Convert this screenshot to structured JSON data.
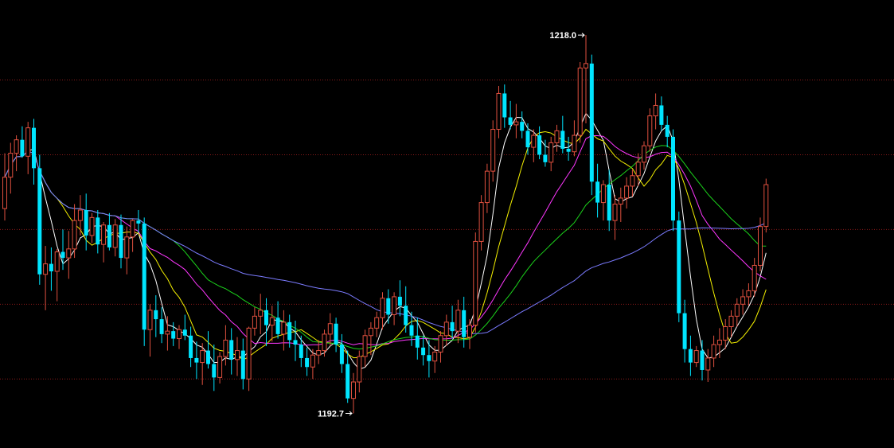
{
  "chart_data": {
    "type": "candlestick",
    "title": "",
    "xlabel": "",
    "ylabel": "",
    "ylim": [
      1191.5,
      1219.5
    ],
    "grid": true,
    "annotations": {
      "high": "1218.0",
      "low": "1192.7"
    },
    "colors": {
      "background": "#000000",
      "grid": "#8a1a1a",
      "up": "#e0503f",
      "down": "#00e5ff",
      "ma1": "#ffffff",
      "ma2": "#f4f000",
      "ma3": "#ff37ff",
      "ma4": "#1bd21b",
      "ma5": "#7b7bff"
    },
    "ohlc": [
      [
        1206.4,
        1210.1,
        1205.6,
        1208.5
      ],
      [
        1208.5,
        1210.8,
        1207.4,
        1210.1
      ],
      [
        1210.1,
        1211.3,
        1208.9,
        1211.0
      ],
      [
        1211.0,
        1211.9,
        1209.8,
        1209.9
      ],
      [
        1209.9,
        1212.2,
        1208.7,
        1211.8
      ],
      [
        1211.8,
        1212.4,
        1208.0,
        1209.1
      ],
      [
        1209.1,
        1210.0,
        1201.3,
        1202.0
      ],
      [
        1202.0,
        1203.9,
        1199.6,
        1202.7
      ],
      [
        1202.7,
        1203.8,
        1200.9,
        1202.2
      ],
      [
        1202.2,
        1203.7,
        1200.2,
        1203.5
      ],
      [
        1203.5,
        1205.0,
        1202.3,
        1203.1
      ],
      [
        1203.1,
        1204.9,
        1201.7,
        1203.7
      ],
      [
        1203.7,
        1206.7,
        1203.1,
        1205.6
      ],
      [
        1205.6,
        1207.3,
        1204.6,
        1206.3
      ],
      [
        1206.3,
        1207.4,
        1203.6,
        1204.6
      ],
      [
        1204.6,
        1206.1,
        1204.1,
        1205.8
      ],
      [
        1205.8,
        1206.3,
        1203.4,
        1204.0
      ],
      [
        1204.0,
        1205.5,
        1202.8,
        1205.3
      ],
      [
        1205.3,
        1206.1,
        1203.6,
        1203.8
      ],
      [
        1203.8,
        1205.7,
        1203.2,
        1205.3
      ],
      [
        1205.3,
        1206.0,
        1202.4,
        1203.1
      ],
      [
        1203.1,
        1205.2,
        1202.0,
        1204.5
      ],
      [
        1204.5,
        1205.7,
        1203.5,
        1205.6
      ],
      [
        1205.6,
        1206.3,
        1204.8,
        1205.4
      ],
      [
        1205.4,
        1205.8,
        1197.2,
        1198.3
      ],
      [
        1198.3,
        1200.0,
        1196.5,
        1199.6
      ],
      [
        1199.6,
        1200.6,
        1197.8,
        1199.0
      ],
      [
        1199.0,
        1199.8,
        1197.4,
        1198.0
      ],
      [
        1198.0,
        1199.2,
        1196.9,
        1198.2
      ],
      [
        1198.2,
        1198.8,
        1197.2,
        1197.7
      ],
      [
        1197.7,
        1198.6,
        1197.0,
        1198.3
      ],
      [
        1198.3,
        1199.3,
        1197.6,
        1197.9
      ],
      [
        1197.9,
        1198.5,
        1195.8,
        1196.4
      ],
      [
        1196.4,
        1197.5,
        1195.0,
        1196.1
      ],
      [
        1196.1,
        1197.4,
        1194.6,
        1196.9
      ],
      [
        1196.9,
        1198.2,
        1195.7,
        1196.0
      ],
      [
        1196.0,
        1197.3,
        1194.2,
        1195.1
      ],
      [
        1195.1,
        1196.8,
        1194.7,
        1196.5
      ],
      [
        1196.5,
        1198.6,
        1195.9,
        1197.6
      ],
      [
        1197.6,
        1198.4,
        1195.3,
        1196.3
      ],
      [
        1196.3,
        1197.8,
        1195.2,
        1196.9
      ],
      [
        1196.9,
        1197.7,
        1194.3,
        1195.0
      ],
      [
        1195.0,
        1198.5,
        1194.2,
        1198.4
      ],
      [
        1198.4,
        1199.8,
        1197.9,
        1199.2
      ],
      [
        1199.2,
        1200.7,
        1198.0,
        1199.6
      ],
      [
        1199.6,
        1200.4,
        1197.2,
        1198.6
      ],
      [
        1198.6,
        1199.9,
        1197.5,
        1199.1
      ],
      [
        1199.1,
        1200.2,
        1197.7,
        1198.0
      ],
      [
        1198.0,
        1199.6,
        1196.9,
        1198.8
      ],
      [
        1198.8,
        1199.3,
        1197.1,
        1197.6
      ],
      [
        1197.6,
        1198.9,
        1196.2,
        1197.3
      ],
      [
        1197.3,
        1197.9,
        1195.8,
        1196.4
      ],
      [
        1196.4,
        1197.1,
        1195.2,
        1195.8
      ],
      [
        1195.8,
        1197.0,
        1195.0,
        1196.6
      ],
      [
        1196.6,
        1197.6,
        1196.0,
        1196.9
      ],
      [
        1196.9,
        1198.3,
        1196.5,
        1198.0
      ],
      [
        1198.0,
        1199.4,
        1197.2,
        1198.7
      ],
      [
        1198.7,
        1199.1,
        1196.8,
        1197.3
      ],
      [
        1197.3,
        1198.0,
        1195.4,
        1196.0
      ],
      [
        1196.0,
        1196.9,
        1193.4,
        1193.7
      ],
      [
        1193.7,
        1195.4,
        1192.7,
        1194.8
      ],
      [
        1194.8,
        1196.9,
        1194.1,
        1196.5
      ],
      [
        1196.5,
        1198.3,
        1195.8,
        1197.9
      ],
      [
        1197.9,
        1198.8,
        1196.6,
        1198.4
      ],
      [
        1198.4,
        1199.5,
        1197.8,
        1199.1
      ],
      [
        1199.1,
        1200.8,
        1198.3,
        1200.4
      ],
      [
        1200.4,
        1201.0,
        1198.7,
        1199.3
      ],
      [
        1199.3,
        1200.8,
        1198.6,
        1200.5
      ],
      [
        1200.5,
        1201.6,
        1199.2,
        1199.9
      ],
      [
        1199.9,
        1201.2,
        1198.1,
        1198.6
      ],
      [
        1198.6,
        1199.5,
        1197.2,
        1197.9
      ],
      [
        1197.9,
        1199.1,
        1196.3,
        1197.1
      ],
      [
        1197.1,
        1197.9,
        1195.9,
        1196.6
      ],
      [
        1196.6,
        1197.6,
        1195.1,
        1196.2
      ],
      [
        1196.2,
        1197.2,
        1195.4,
        1196.8
      ],
      [
        1196.8,
        1198.2,
        1196.1,
        1197.9
      ],
      [
        1197.9,
        1199.3,
        1197.2,
        1198.8
      ],
      [
        1198.8,
        1199.9,
        1197.7,
        1198.2
      ],
      [
        1198.2,
        1200.3,
        1197.4,
        1199.6
      ],
      [
        1199.6,
        1200.5,
        1197.1,
        1197.8
      ],
      [
        1197.8,
        1199.0,
        1197.0,
        1198.6
      ],
      [
        1198.6,
        1204.8,
        1198.1,
        1204.2
      ],
      [
        1204.2,
        1207.3,
        1203.6,
        1206.8
      ],
      [
        1206.8,
        1209.4,
        1206.1,
        1208.9
      ],
      [
        1208.9,
        1212.3,
        1208.2,
        1211.7
      ],
      [
        1211.7,
        1214.6,
        1211.1,
        1214.1
      ],
      [
        1214.1,
        1214.7,
        1211.8,
        1212.5
      ],
      [
        1212.5,
        1213.6,
        1211.7,
        1212.0
      ],
      [
        1212.0,
        1213.4,
        1211.1,
        1212.2
      ],
      [
        1212.2,
        1212.9,
        1211.1,
        1211.6
      ],
      [
        1211.6,
        1212.1,
        1210.0,
        1210.5
      ],
      [
        1210.5,
        1211.7,
        1209.5,
        1211.3
      ],
      [
        1211.3,
        1211.9,
        1209.7,
        1210.0
      ],
      [
        1210.0,
        1211.0,
        1209.2,
        1209.5
      ],
      [
        1209.5,
        1211.2,
        1208.9,
        1210.8
      ],
      [
        1210.8,
        1212.0,
        1210.2,
        1211.6
      ],
      [
        1211.6,
        1212.6,
        1210.1,
        1210.4
      ],
      [
        1210.4,
        1211.2,
        1209.6,
        1210.2
      ],
      [
        1210.2,
        1212.3,
        1209.9,
        1211.3
      ],
      [
        1211.3,
        1216.2,
        1210.8,
        1215.8
      ],
      [
        1215.8,
        1218.0,
        1212.1,
        1216.1
      ],
      [
        1216.1,
        1216.7,
        1207.3,
        1208.2
      ],
      [
        1208.2,
        1209.4,
        1205.8,
        1206.8
      ],
      [
        1206.8,
        1208.3,
        1205.6,
        1208.0
      ],
      [
        1208.0,
        1209.0,
        1204.9,
        1205.6
      ],
      [
        1205.6,
        1207.3,
        1204.3,
        1206.7
      ],
      [
        1206.7,
        1207.8,
        1205.5,
        1207.1
      ],
      [
        1207.1,
        1208.5,
        1206.4,
        1207.9
      ],
      [
        1207.9,
        1209.0,
        1207.2,
        1208.6
      ],
      [
        1208.6,
        1210.1,
        1207.9,
        1209.5
      ],
      [
        1209.5,
        1210.9,
        1209.0,
        1210.6
      ],
      [
        1210.6,
        1213.1,
        1210.2,
        1212.6
      ],
      [
        1212.6,
        1214.1,
        1211.7,
        1213.3
      ],
      [
        1213.3,
        1213.9,
        1211.6,
        1212.0
      ],
      [
        1212.0,
        1212.6,
        1210.5,
        1211.2
      ],
      [
        1211.2,
        1211.7,
        1204.9,
        1205.6
      ],
      [
        1205.6,
        1206.2,
        1198.8,
        1199.4
      ],
      [
        1199.4,
        1200.3,
        1196.1,
        1197.0
      ],
      [
        1197.0,
        1197.9,
        1195.2,
        1196.1
      ],
      [
        1196.1,
        1197.2,
        1195.8,
        1196.9
      ],
      [
        1196.9,
        1197.6,
        1194.9,
        1195.6
      ],
      [
        1195.6,
        1197.0,
        1194.8,
        1196.4
      ],
      [
        1196.4,
        1197.9,
        1195.8,
        1197.3
      ],
      [
        1197.3,
        1198.4,
        1196.4,
        1197.6
      ],
      [
        1197.6,
        1199.0,
        1197.0,
        1198.5
      ],
      [
        1198.5,
        1199.6,
        1197.8,
        1199.2
      ],
      [
        1199.2,
        1200.4,
        1198.5,
        1200.0
      ],
      [
        1200.0,
        1201.0,
        1199.3,
        1200.5
      ],
      [
        1200.5,
        1201.4,
        1199.9,
        1200.9
      ],
      [
        1200.9,
        1203.1,
        1200.5,
        1202.6
      ],
      [
        1202.6,
        1205.8,
        1202.2,
        1205.2
      ],
      [
        1205.2,
        1208.4,
        1204.8,
        1208.0
      ]
    ],
    "ma_periods": [
      5,
      10,
      20,
      30,
      60
    ]
  }
}
